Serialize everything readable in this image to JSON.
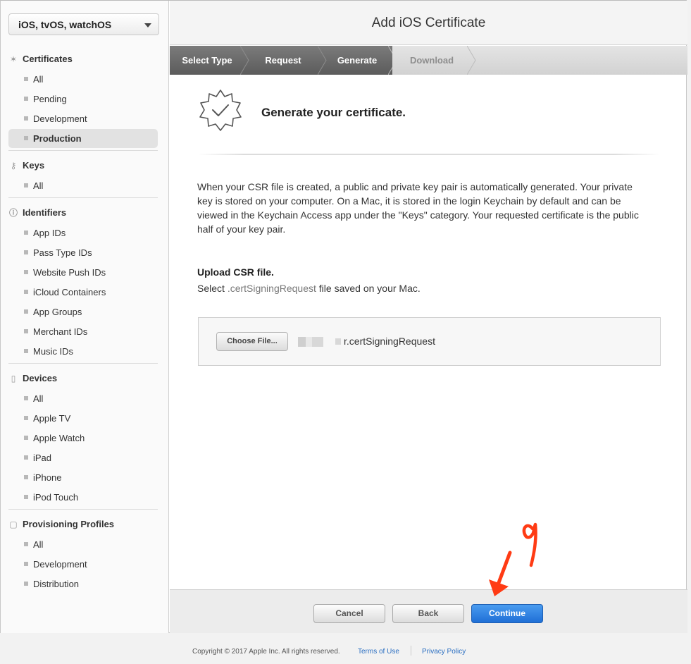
{
  "sidebar": {
    "platform": "iOS, tvOS, watchOS",
    "sections": [
      {
        "title": "Certificates",
        "icon": "gear-badge-icon",
        "items": [
          "All",
          "Pending",
          "Development",
          "Production"
        ]
      },
      {
        "title": "Keys",
        "icon": "key-icon",
        "items": [
          "All"
        ]
      },
      {
        "title": "Identifiers",
        "icon": "id-icon",
        "items": [
          "App IDs",
          "Pass Type IDs",
          "Website Push IDs",
          "iCloud Containers",
          "App Groups",
          "Merchant IDs",
          "Music IDs"
        ]
      },
      {
        "title": "Devices",
        "icon": "device-icon",
        "items": [
          "All",
          "Apple TV",
          "Apple Watch",
          "iPad",
          "iPhone",
          "iPod Touch"
        ]
      },
      {
        "title": "Provisioning Profiles",
        "icon": "document-icon",
        "items": [
          "All",
          "Development",
          "Distribution"
        ]
      }
    ],
    "active_item": "Production"
  },
  "header": {
    "title": "Add iOS Certificate"
  },
  "steps": [
    "Select Type",
    "Request",
    "Generate",
    "Download"
  ],
  "current_step": "Generate",
  "content": {
    "heading": "Generate your certificate.",
    "description": "When your CSR file is created, a public and private key pair is automatically generated. Your private key is stored on your computer. On a Mac, it is stored in the login Keychain by default and can be viewed in the Keychain Access app under the \"Keys\" category. Your requested certificate is the public half of your key pair.",
    "upload_title": "Upload CSR file.",
    "upload_sub_prefix": "Select",
    "upload_sub_ext": ".certSigningRequest",
    "upload_sub_suffix": "file saved on your Mac.",
    "choose_file_label": "Choose File...",
    "file_name": "r.certSigningRequest"
  },
  "buttons": {
    "cancel": "Cancel",
    "back": "Back",
    "continue": "Continue"
  },
  "footer": {
    "copyright": "Copyright © 2017 Apple Inc. All rights reserved.",
    "terms": "Terms of Use",
    "privacy": "Privacy Policy"
  },
  "annotation": {
    "label": "9",
    "color": "#ff3b14"
  }
}
